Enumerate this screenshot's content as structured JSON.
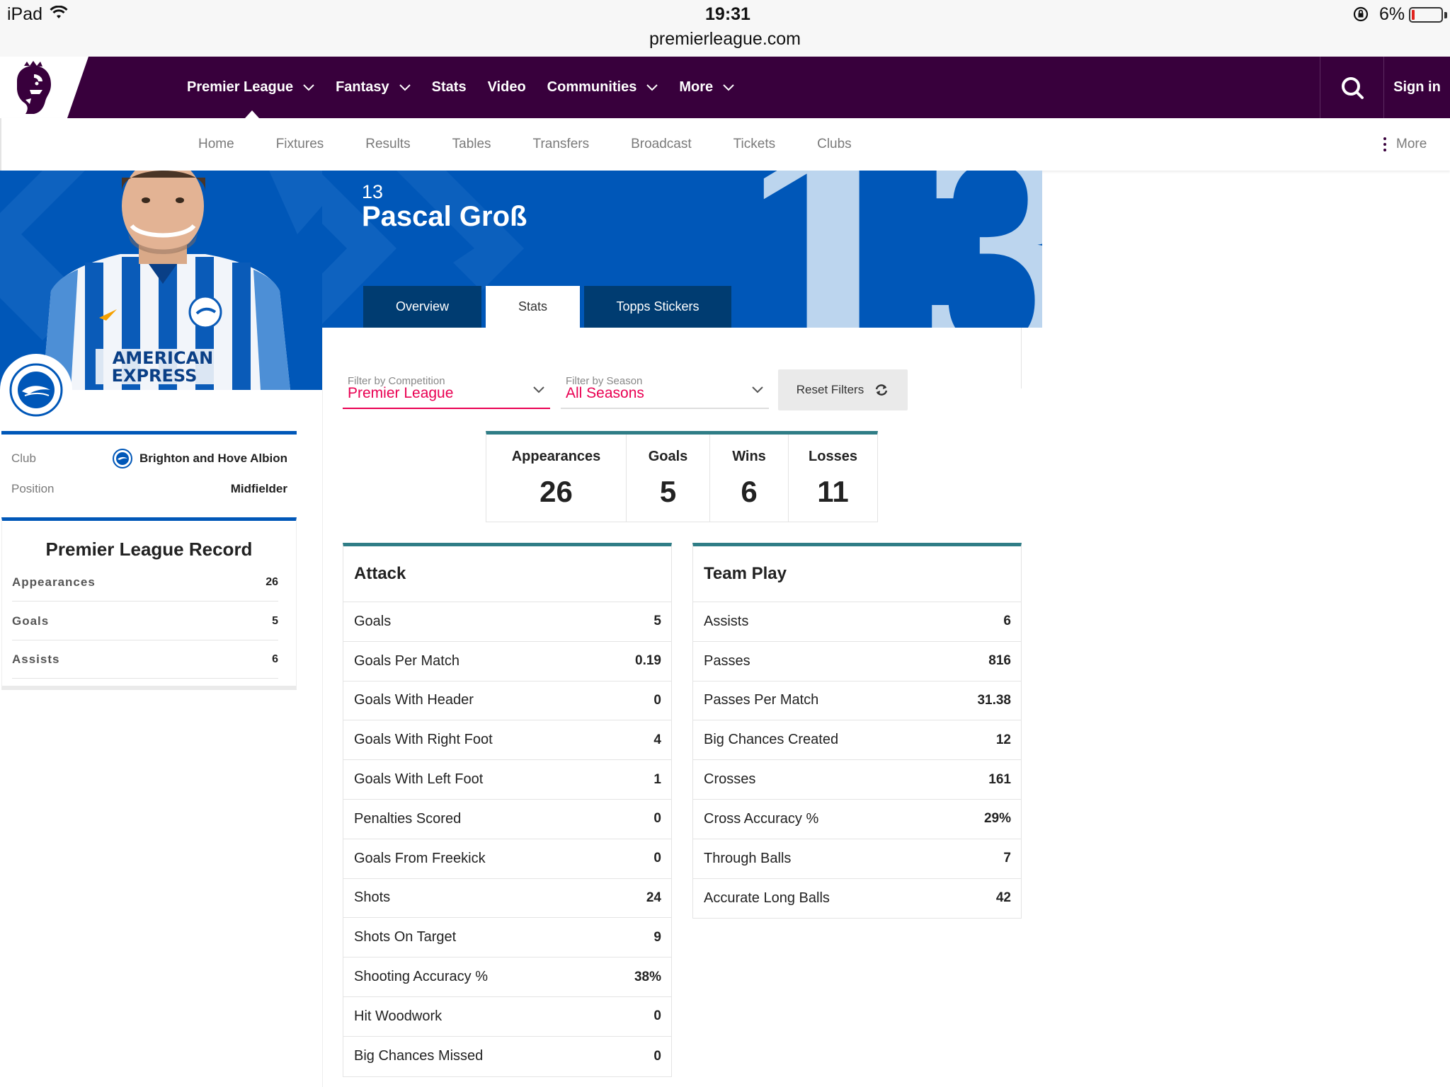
{
  "status_bar": {
    "device": "iPad",
    "time": "19:31",
    "url": "premierleague.com",
    "battery": "6%",
    "battery_level": 0.06
  },
  "main_nav": {
    "items": [
      {
        "label": "Premier League",
        "dropdown": true
      },
      {
        "label": "Fantasy",
        "dropdown": true
      },
      {
        "label": "Stats",
        "dropdown": false
      },
      {
        "label": "Video",
        "dropdown": false
      },
      {
        "label": "Communities",
        "dropdown": true
      },
      {
        "label": "More",
        "dropdown": true
      }
    ],
    "sign_in": "Sign in"
  },
  "sub_nav": {
    "items": [
      "Home",
      "Fixtures",
      "Results",
      "Tables",
      "Transfers",
      "Broadcast",
      "Tickets",
      "Clubs"
    ],
    "more": "More"
  },
  "player": {
    "number": "13",
    "big_number": "13",
    "name": "Pascal Groß",
    "shirt_sponsor": "AMERICAN EXPRESS"
  },
  "tabs": [
    "Overview",
    "Stats",
    "Topps Stickers"
  ],
  "active_tab": "Stats",
  "sidebar": {
    "club_label": "Club",
    "club_value": "Brighton and Hove Albion",
    "position_label": "Position",
    "position_value": "Midfielder",
    "record_title": "Premier League Record",
    "record": [
      {
        "label": "Appearances",
        "value": "26"
      },
      {
        "label": "Goals",
        "value": "5"
      },
      {
        "label": "Assists",
        "value": "6"
      }
    ]
  },
  "filters": {
    "competition_label": "Filter by Competition",
    "competition_value": "Premier League",
    "season_label": "Filter by Season",
    "season_value": "All Seasons",
    "reset": "Reset Filters"
  },
  "summary": [
    {
      "label": "Appearances",
      "value": "26"
    },
    {
      "label": "Goals",
      "value": "5"
    },
    {
      "label": "Wins",
      "value": "6"
    },
    {
      "label": "Losses",
      "value": "11"
    }
  ],
  "attack": {
    "title": "Attack",
    "rows": [
      {
        "label": "Goals",
        "value": "5"
      },
      {
        "label": "Goals Per Match",
        "value": "0.19"
      },
      {
        "label": "Goals With Header",
        "value": "0"
      },
      {
        "label": "Goals With Right Foot",
        "value": "4"
      },
      {
        "label": "Goals With Left Foot",
        "value": "1"
      },
      {
        "label": "Penalties Scored",
        "value": "0"
      },
      {
        "label": "Goals From Freekick",
        "value": "0"
      },
      {
        "label": "Shots",
        "value": "24"
      },
      {
        "label": "Shots On Target",
        "value": "9"
      },
      {
        "label": "Shooting Accuracy %",
        "value": "38%"
      },
      {
        "label": "Hit Woodwork",
        "value": "0"
      },
      {
        "label": "Big Chances Missed",
        "value": "0"
      }
    ]
  },
  "team_play": {
    "title": "Team Play",
    "rows": [
      {
        "label": "Assists",
        "value": "6"
      },
      {
        "label": "Passes",
        "value": "816"
      },
      {
        "label": "Passes Per Match",
        "value": "31.38"
      },
      {
        "label": "Big Chances Created",
        "value": "12"
      },
      {
        "label": "Crosses",
        "value": "161"
      },
      {
        "label": "Cross Accuracy %",
        "value": "29%"
      },
      {
        "label": "Through Balls",
        "value": "7"
      },
      {
        "label": "Accurate Long Balls",
        "value": "42"
      }
    ]
  },
  "colors": {
    "pl_purple": "#38003c",
    "brighton_blue": "#0057b8",
    "tab_dark": "#003c71",
    "accent_pink": "#e90052",
    "table_border_teal": "#2f7d86"
  }
}
